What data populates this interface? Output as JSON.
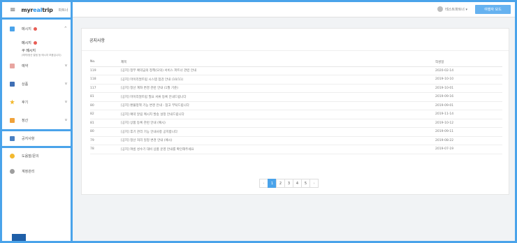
{
  "sidebar": {
    "hamburger": "≡",
    "logo_prefix": "myr",
    "logo_accent": "eal",
    "logo_suffix": "trip",
    "partner_label": "파트너",
    "menu": {
      "message": "메시지",
      "message_sub": "메시지",
      "message_sub2": "쿠 메시지",
      "message_note": "(예약/정산 알림 등 메시지 모음입니다)",
      "reservation": "예약",
      "product": "상품",
      "review": "후기",
      "settlement": "정산",
      "notice": "공지사항",
      "help": "도움말/문의",
      "account": "계정관리"
    }
  },
  "header": {
    "user_name": "테스트파트너 ▾",
    "mode_button": "여행자 모드"
  },
  "card": {
    "title": "공지사항",
    "columns": {
      "no": "No.",
      "title": "제목",
      "date": "작성일"
    },
    "rows": [
      {
        "no": "119",
        "title": "[공지] 정부 예약금의 정책(모의) 서비스 파트너 관련 안내",
        "date": "2020-02-14"
      },
      {
        "no": "118",
        "title": "[공지] 마이리얼트립 시스템 점검 안내 (10/11)",
        "date": "2019-10-10"
      },
      {
        "no": "117",
        "title": "[공지] 정산 계좌 변경 관련 안내 (1월 기준)",
        "date": "2019-10-01"
      },
      {
        "no": "81",
        "title": "[공지] 마이리얼트립 필요 서류 등록 안내드립니다",
        "date": "2019-09-16"
      },
      {
        "no": "80",
        "title": "[공지] 환불정책 기능 변경 안내 - 참고 부탁드립니다",
        "date": "2019-09-01"
      },
      {
        "no": "82",
        "title": "[공지] 예약 알림 메시지 발송 설정 안내드립니다",
        "date": "2019-11-14"
      },
      {
        "no": "81",
        "title": "[공지] 상품 등록 관련 안내 (예시)",
        "date": "2019-10-12"
      },
      {
        "no": "80",
        "title": "[공지] 후기 관리 기능 안내사항 공지합니다",
        "date": "2019-09-11"
      },
      {
        "no": "79",
        "title": "[공지] 정산 처리 일정 변경 안내 (예시)",
        "date": "2019-08-22"
      },
      {
        "no": "78",
        "title": "[공지] 여름 성수기 대비 상품 운영 안내를 확인해주세요",
        "date": "2019-07-19"
      }
    ]
  },
  "pagination": {
    "prev": "‹",
    "pages": [
      "1",
      "2",
      "3",
      "4",
      "5"
    ],
    "next": "›",
    "active": "1"
  },
  "colors": {
    "accent": "#4aa3ea",
    "button": "#66b2f0",
    "badge": "#e85d55"
  }
}
